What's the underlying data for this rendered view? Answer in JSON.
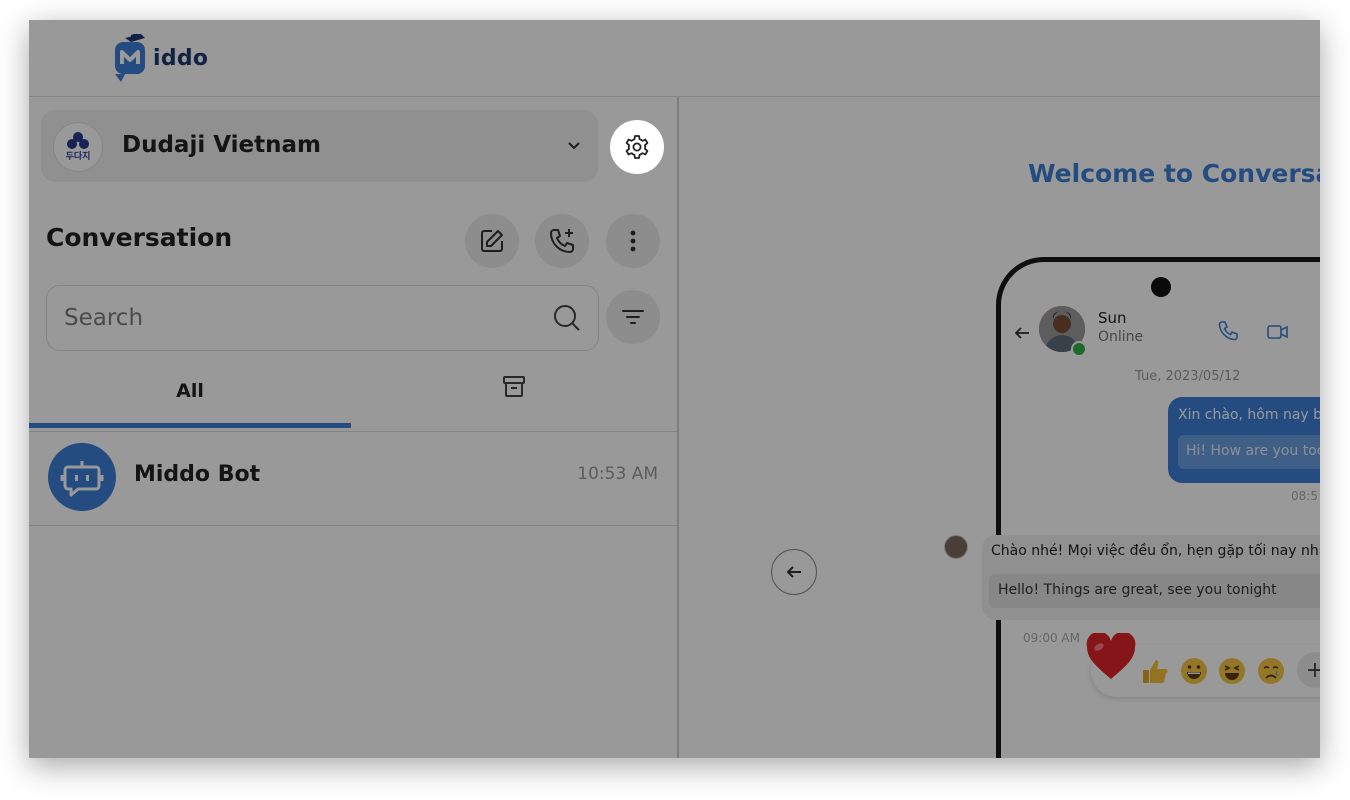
{
  "app": {
    "logo_text": "iddo"
  },
  "workspace": {
    "name": "Dudaji Vietnam",
    "avatar_text": "두다지"
  },
  "conversation_panel": {
    "title": "Conversation",
    "search_placeholder": "Search",
    "tabs": [
      {
        "label": "All",
        "active": true
      },
      {
        "icon": "archive-icon"
      }
    ]
  },
  "conversations": [
    {
      "name": "Middo Bot",
      "time": "10:53 AM",
      "avatar_icon": "bot-icon"
    }
  ],
  "welcome": {
    "title": "Welcome to Conversatio",
    "phone": {
      "contact_name": "Sun",
      "contact_status": "Online",
      "date": "Tue, 2023/05/12",
      "outgoing": {
        "text": "Xin chào, hôm nay b",
        "translation": "Hi! How are you toc",
        "time": "08:5"
      },
      "incoming": {
        "text": "Chào nhé! Mọi việc đều ổn, hẹn gặp tối nay nh",
        "translation": "Hello! Things are great, see you tonight",
        "time": "09:00 AM"
      },
      "reactions": [
        "heart",
        "thumbs-up",
        "grinning",
        "laughing",
        "crying"
      ],
      "reaction_more": "+"
    }
  },
  "colors": {
    "accent": "#3c7fd6",
    "overlay": "rgba(0,0,0,0.40)",
    "brand_dark": "#1e3a70"
  }
}
